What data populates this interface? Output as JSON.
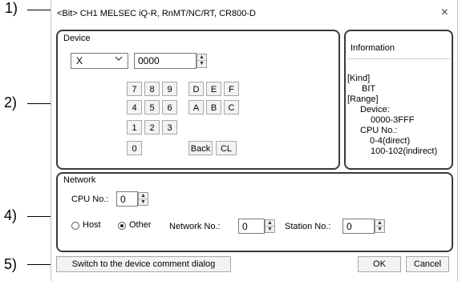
{
  "callouts": [
    "1)",
    "2)",
    "4)",
    "5)"
  ],
  "title": "<Bit> CH1 MELSEC iQ-R, RnMT/NC/RT, CR800-D",
  "close_glyph": "×",
  "device": {
    "label": "Device",
    "type_value": "X",
    "address_value": "0000",
    "keys": [
      "7",
      "8",
      "9",
      "D",
      "E",
      "F",
      "4",
      "5",
      "6",
      "A",
      "B",
      "C",
      "1",
      "2",
      "3",
      "0"
    ],
    "back_label": "Back",
    "cl_label": "CL"
  },
  "information": {
    "label": "Information",
    "lines": [
      "[Kind]",
      "BIT",
      "[Range]",
      "Device:",
      "0000-3FFF",
      "CPU No.:",
      "0-4(direct)",
      "100-102(indirect)"
    ]
  },
  "network": {
    "label": "Network",
    "cpu_no_label": "CPU No.:",
    "cpu_no_value": "0",
    "host_label": "Host",
    "other_label": "Other",
    "selected": "Other",
    "network_no_label": "Network No.:",
    "network_no_value": "0",
    "station_no_label": "Station No.:",
    "station_no_value": "0"
  },
  "footer": {
    "switch_label": "Switch to the device comment dialog",
    "ok_label": "OK",
    "cancel_label": "Cancel"
  },
  "icons": {
    "dropdown": "chevron-down-icon",
    "spin_up": "▲",
    "spin_down": "▼"
  }
}
